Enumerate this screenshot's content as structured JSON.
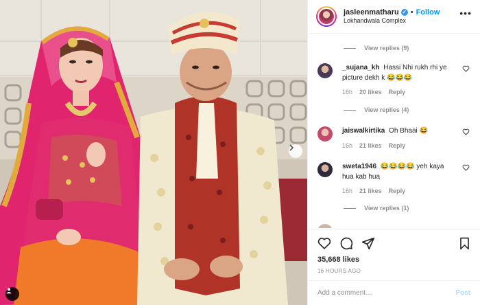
{
  "header": {
    "username": "jasleenmatharu",
    "verified_glyph": "✓",
    "separator": "•",
    "follow_label": "Follow",
    "location": "Lokhandwala Complex",
    "more_icon": "more-options-icon"
  },
  "comments": {
    "view_replies_1": "View replies (9)",
    "view_replies_2": "View replies (4)",
    "view_replies_3": "View replies (1)",
    "items": [
      {
        "username": "_sujana_kh",
        "text": "Hassi Nhi rukh rhi ye picture dekh k 😂😂😂",
        "age": "16h",
        "likes": "20 likes",
        "reply": "Reply"
      },
      {
        "username": "jaiswalkirtika",
        "text": "Oh Bhaai 😂",
        "age": "16h",
        "likes": "21 likes",
        "reply": "Reply"
      },
      {
        "username": "sweta1946",
        "text": "😂😂😂😂 yeh kaya hua kab hua",
        "age": "16h",
        "likes": "21 likes",
        "reply": "Reply"
      }
    ]
  },
  "actions": {
    "likes": "35,668 likes",
    "timestamp": "16 HOURS AGO"
  },
  "add_comment": {
    "placeholder": "Add a comment…",
    "post_label": "Post"
  },
  "colors": {
    "accent": "#0095f6",
    "verified": "#3897f0",
    "muted": "#8e8e8e",
    "post_disabled": "#b2dffc"
  }
}
